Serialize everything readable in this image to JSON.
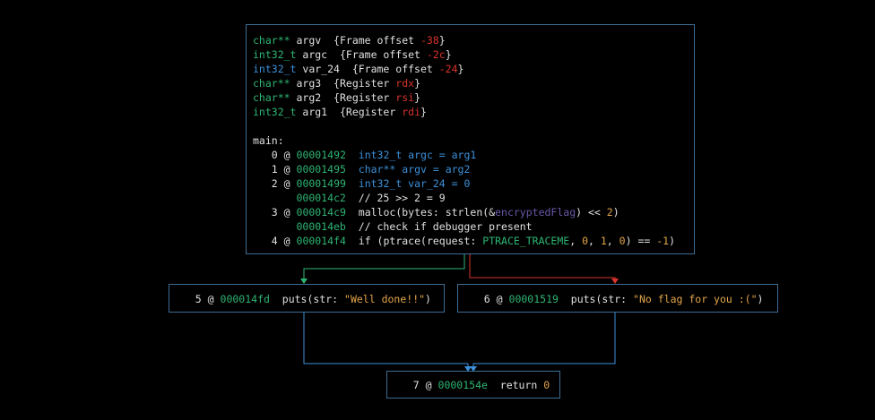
{
  "main_block": {
    "vars": [
      {
        "type": "char**",
        "name": "argv",
        "note_prefix": "{Frame offset ",
        "note_val": "-38",
        "note_suffix": "}"
      },
      {
        "type": "int32_t",
        "name": "argc",
        "note_prefix": "{Frame offset ",
        "note_val": "-2c",
        "note_suffix": "}"
      },
      {
        "type": "int32_t",
        "name": "var_24",
        "note_prefix": "{Frame offset ",
        "note_val": "-24",
        "note_suffix": "}"
      },
      {
        "type": "char**",
        "name": "arg3",
        "note_prefix": "{Register ",
        "note_val": "rdx",
        "note_suffix": "}"
      },
      {
        "type": "char**",
        "name": "arg2",
        "note_prefix": "{Register ",
        "note_val": "rsi",
        "note_suffix": "}"
      },
      {
        "type": "int32_t",
        "name": "arg1",
        "note_prefix": "{Register ",
        "note_val": "rdi",
        "note_suffix": "}"
      }
    ],
    "label": "main:",
    "instrs": [
      {
        "idx": "0",
        "at": "@",
        "addr": "00001492",
        "p1": "int32_t argc = arg1"
      },
      {
        "idx": "1",
        "at": "@",
        "addr": "00001495",
        "p1": "char** argv = arg2"
      },
      {
        "idx": "2",
        "at": "@",
        "addr": "00001499",
        "p1": "int32_t var_24 = 0"
      },
      {
        "idx": "",
        "at": "",
        "addr": "000014c2",
        "p1": "// 25 >> 2 = 9"
      },
      {
        "idx": "3",
        "at": "@",
        "addr": "000014c9",
        "p1": "malloc(bytes: strlen(&",
        "p2": "encryptedFlag",
        "p3": ") << ",
        "p4": "2",
        "p5": ")"
      },
      {
        "idx": "",
        "at": "",
        "addr": "000014eb",
        "p1": "// check if debugger present"
      },
      {
        "idx": "4",
        "at": "@",
        "addr": "000014f4",
        "p1": "if (ptrace(request: ",
        "p2": "PTRACE_TRACEME",
        "p3": ", ",
        "p4": "0",
        "p5": ", ",
        "p6": "1",
        "p7": ", ",
        "p8": "0",
        "p9": ") == ",
        "p10": "-1",
        "p11": ")"
      }
    ]
  },
  "block_true": {
    "idx": "5",
    "at": "@",
    "addr": "000014fd",
    "call": "puts(str: ",
    "str": "\"Well done!!\"",
    "end": ")"
  },
  "block_false": {
    "idx": "6",
    "at": "@",
    "addr": "00001519",
    "call": "puts(str: ",
    "str": "\"No flag for you :(\"",
    "end": ")"
  },
  "block_ret": {
    "idx": "7",
    "at": "@",
    "addr": "0000154e",
    "kw": "return ",
    "val": "0"
  },
  "colors": {
    "true_edge": "#2fb573",
    "false_edge": "#d9342b",
    "merge_edge": "#3c8fd8",
    "node_border": "#3f6d94"
  }
}
